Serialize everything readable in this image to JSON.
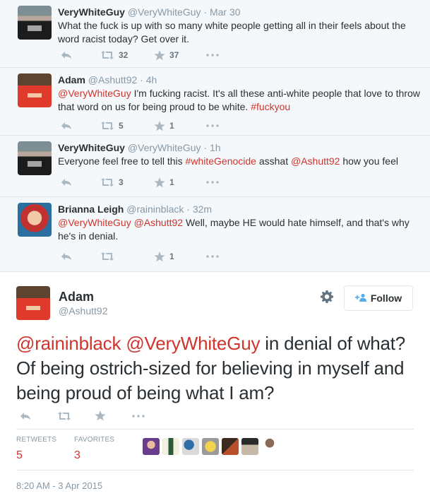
{
  "thread": [
    {
      "name": "VeryWhiteGuy",
      "handle": "@VeryWhiteGuy",
      "time": "Mar 30",
      "parts": [
        {
          "text": "What the fuck is up with so many white people getting all in their feels about the word racist today? Get over it.",
          "kind": "plain"
        }
      ],
      "retweets": "32",
      "favorites": "37",
      "avatar": "verywhiteguy-avatar"
    },
    {
      "name": "Adam",
      "handle": "@Ashutt92",
      "time": "4h",
      "parts": [
        {
          "text": "@VeryWhiteGuy",
          "kind": "mention"
        },
        {
          "text": " I'm fucking racist. It's all these anti-white people that love to throw that word on us for being proud to be white. ",
          "kind": "plain"
        },
        {
          "text": "#fuckyou",
          "kind": "hashtag"
        }
      ],
      "retweets": "5",
      "favorites": "1",
      "avatar": "adam-avatar"
    },
    {
      "name": "VeryWhiteGuy",
      "handle": "@VeryWhiteGuy",
      "time": "1h",
      "parts": [
        {
          "text": "Everyone feel free to tell this ",
          "kind": "plain"
        },
        {
          "text": "#whiteGenocide",
          "kind": "hashtag"
        },
        {
          "text": " asshat ",
          "kind": "plain"
        },
        {
          "text": "@Ashutt92",
          "kind": "mention"
        },
        {
          "text": " how you feel",
          "kind": "plain"
        }
      ],
      "retweets": "3",
      "favorites": "1",
      "avatar": "verywhiteguy-avatar"
    },
    {
      "name": "Brianna Leigh",
      "handle": "@raininblack",
      "time": "32m",
      "parts": [
        {
          "text": "@VeryWhiteGuy",
          "kind": "mention"
        },
        {
          "text": " ",
          "kind": "plain"
        },
        {
          "text": "@Ashutt92",
          "kind": "mention"
        },
        {
          "text": " Well, maybe HE would hate himself, and that's why he's in denial.",
          "kind": "plain"
        }
      ],
      "retweets": "",
      "favorites": "1",
      "avatar": "brianna-avatar"
    }
  ],
  "focus": {
    "name": "Adam",
    "handle": "@Ashutt92",
    "follow_label": "Follow",
    "parts": [
      {
        "text": "@raininblack",
        "kind": "mention"
      },
      {
        "text": " ",
        "kind": "plain"
      },
      {
        "text": "@VeryWhiteGuy",
        "kind": "mention"
      },
      {
        "text": " in denial of what? Of being ostrich-sized for believing in myself and being proud of being what I am?",
        "kind": "plain"
      }
    ],
    "stats": {
      "retweets_label": "RETWEETS",
      "retweets": "5",
      "favorites_label": "FAVORITES",
      "favorites": "3"
    },
    "favoriters_count": 7,
    "timestamp": "8:20 AM - 3 Apr 2015"
  },
  "colors": {
    "link": "#d0342c",
    "muted": "#8899a6",
    "text": "#292f33",
    "thread_bg": "#f5f8fa"
  }
}
